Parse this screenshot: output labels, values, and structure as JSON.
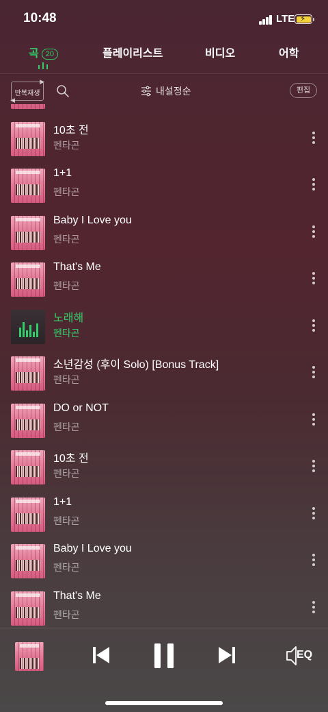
{
  "status_bar": {
    "time": "10:48",
    "network": "LTE",
    "icons": [
      "signal-icon",
      "battery-charging-icon"
    ]
  },
  "tabs": [
    {
      "label": "곡",
      "count": "20",
      "active": true
    },
    {
      "label": "플레이리스트",
      "active": false
    },
    {
      "label": "비디오",
      "active": false
    },
    {
      "label": "어학",
      "active": false
    }
  ],
  "toolbar": {
    "repeat_label": "반복재생",
    "sort_label": "내설정순",
    "edit_label": "편집"
  },
  "songs": [
    {
      "title": "",
      "artist": "펜타곤"
    },
    {
      "title": "10초 전",
      "artist": "펜타곤"
    },
    {
      "title": "1+1",
      "artist": "펜타곤"
    },
    {
      "title": "Baby I Love you",
      "artist": "펜타곤"
    },
    {
      "title": "That's Me",
      "artist": "펜타곤"
    },
    {
      "title": "노래해",
      "artist": "펜타곤",
      "playing": true
    },
    {
      "title": "소년감성 (후이 Solo) [Bonus Track]",
      "artist": "펜타곤"
    },
    {
      "title": "DO or NOT",
      "artist": "펜타곤"
    },
    {
      "title": "10초 전",
      "artist": "펜타곤"
    },
    {
      "title": "1+1",
      "artist": "펜타곤"
    },
    {
      "title": "Baby I Love you",
      "artist": "펜타곤"
    },
    {
      "title": "That's Me",
      "artist": "펜타곤"
    }
  ],
  "player": {
    "eq_label": "EQ",
    "state": "playing"
  },
  "colors": {
    "accent": "#33cc6a",
    "background": "#4d2833"
  }
}
